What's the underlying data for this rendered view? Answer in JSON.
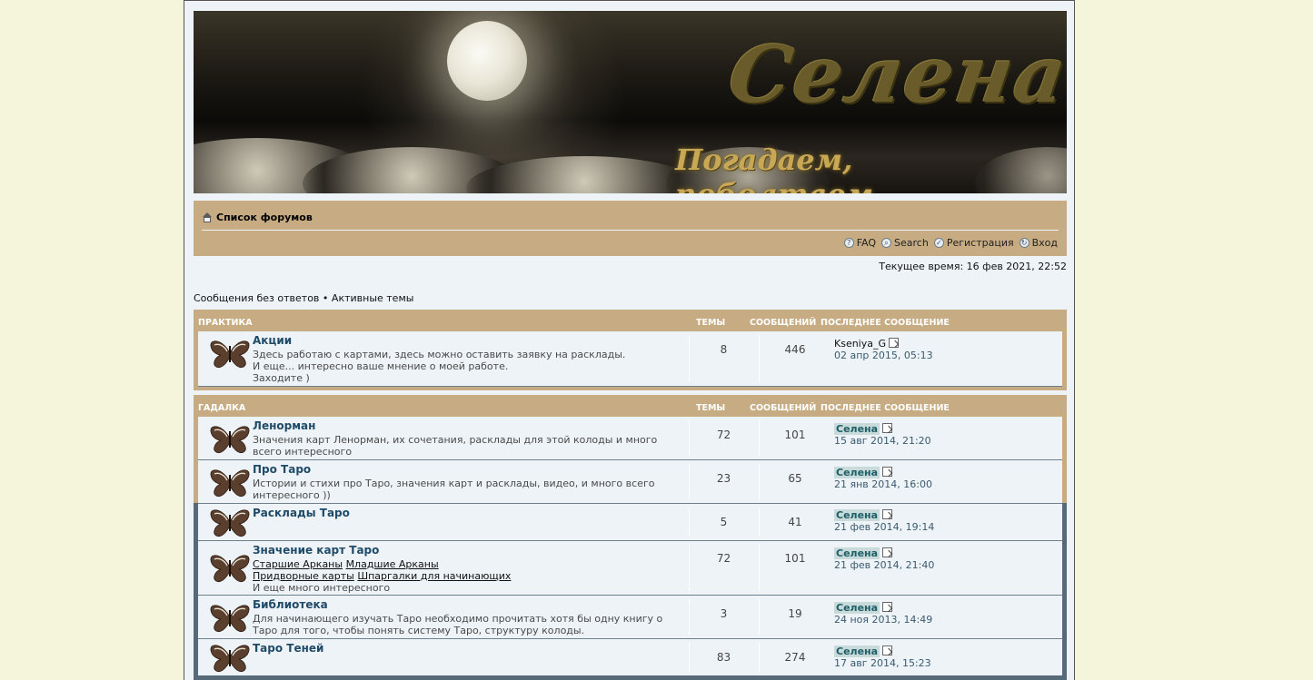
{
  "banner": {
    "title": "Селена",
    "subtitle": "Погадаем, поболтаем....."
  },
  "navbar": {
    "breadcrumb": "Список форумов",
    "links": [
      {
        "label": "FAQ",
        "icon": "faq-icon"
      },
      {
        "label": "Search",
        "icon": "search-icon"
      },
      {
        "label": "Регистрация",
        "icon": "register-icon"
      },
      {
        "label": "Вход",
        "icon": "login-icon"
      }
    ]
  },
  "current_time": "Текущее время: 16 фев 2021, 22:52",
  "quick_links": {
    "unanswered": "Сообщения без ответов",
    "separator": "•",
    "active": "Активные темы"
  },
  "columns": {
    "topics": "ТЕМЫ",
    "posts": "СООБЩЕНИЙ",
    "last_post": "ПОСЛЕДНЕЕ СООБЩЕНИЕ"
  },
  "categories": [
    {
      "name": "ПРАКТИКА",
      "forums": [
        {
          "name": "Акции",
          "desc": [
            "Здесь работаю с картами, здесь можно оставить заявку на расклады.",
            "И еще... интересно ваше мнение о моей работе.",
            "Заходите )"
          ],
          "topics": "8",
          "posts": "446",
          "last_author": "Kseniya_G",
          "last_date": "02 апр 2015, 05:13"
        }
      ]
    },
    {
      "name": "ГАДАЛКА",
      "forums": [
        {
          "name": "Ленорман",
          "desc": [
            "Значения карт Ленорман, их сочетания, расклады для этой колоды и много всего интересного"
          ],
          "topics": "72",
          "posts": "101",
          "last_author": "Селена",
          "last_date": "15 авг 2014, 21:20"
        },
        {
          "name": "Про Таро",
          "desc": [
            "Истории и стихи про Таро, значения карт и расклады, видео, и много всего интересного ))"
          ],
          "topics": "23",
          "posts": "65",
          "last_author": "Селена",
          "last_date": "21 янв 2014, 16:00"
        },
        {
          "name": "Расклады Таро",
          "desc": [],
          "topics": "5",
          "posts": "41",
          "last_author": "Селена",
          "last_date": "21 фев 2014, 19:14"
        },
        {
          "name": "Значение карт Таро",
          "subforums": [
            "Старшие Арканы",
            "Младшие Арканы",
            "Придворные карты",
            "Шпаргалки для начинающих"
          ],
          "desc_tail": "И еще много интересного",
          "topics": "72",
          "posts": "101",
          "last_author": "Селена",
          "last_date": "21 фев 2014, 21:40"
        },
        {
          "name": "Библиотека",
          "desc": [
            "Для начинающего изучать Таро необходимо прочитать хотя бы одну книгу о Таро для того, чтобы понять систему Таро, структуру колоды."
          ],
          "topics": "3",
          "posts": "19",
          "last_author": "Селена",
          "last_date": "24 ноя 2013, 14:49"
        },
        {
          "name": "Таро Теней",
          "desc": [],
          "topics": "83",
          "posts": "274",
          "last_author": "Селена",
          "last_date": "17 авг 2014, 15:23"
        }
      ]
    }
  ]
}
